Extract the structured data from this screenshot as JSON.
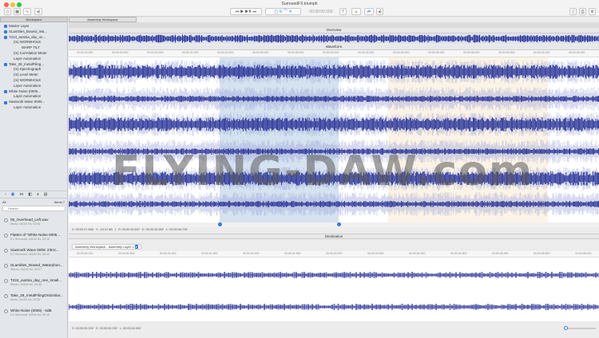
{
  "window": {
    "title": "SurroundFX.triumph",
    "timecode": "00:00:00.000"
  },
  "sidebar": {
    "tab": "Workspace",
    "tree": [
      "Master Layer",
      "SLambles_Bowed_Wa...",
      "T224_austria_day_on...",
      "(m) WORMHOLE",
      "WARP TILT",
      "(m) Correlation Meter",
      "Layer Automation",
      "Take_28_metalFiling...",
      "(m) Spectrograph",
      "(m) Level Meter",
      "(m) WORMHOLE",
      "Layer Automation",
      "White Noise (0005...",
      "Layer Automation",
      "Sawtooth Wave 0006...",
      "Layer Automation"
    ],
    "filter_all": "All",
    "items_label": "Items 7",
    "search_placeholder": "Search",
    "items": [
      {
        "name": "06_Overhead_Left.wav",
        "sub": "Mono, 44100 Hz, 00:05"
      },
      {
        "name": "Flatten of \"White Noise 0005...",
        "sub": "5.1 Surround, 44100 Hz, 00:10"
      },
      {
        "name": "Sawtooth Wave 0006: 23Hz...",
        "sub": "5.1 Surround, 44100 Hz, 00:10"
      },
      {
        "name": "SLambles_Bowed_Waterphon...",
        "sub": "Stereo, 44100 Hz, 00:27"
      },
      {
        "name": "T224_austria_day_one_small...",
        "sub": "Stereo, 44100 Hz, 00:45"
      },
      {
        "name": "Take_28_metalFilingOnSimilar...",
        "sub": "Mono, 44100 Hz, 00:30"
      },
      {
        "name": "White Noise (0005) - 6dB",
        "sub": "5.1 Surround, 44100 Hz, 00:10"
      }
    ]
  },
  "main": {
    "tab": "Assembly Workspace",
    "clips": [
      "Master Layer",
      "SLambles_Bowed_Waterph...",
      "T224_austria_day_one_sm...",
      "Take_28_metalFilingOnSim...",
      "White Noise 0005 - 6dB",
      "Sawtooth Wave 0006: 23H..."
    ],
    "overview_label": "Overview",
    "waveform_label": "Waveform",
    "ruler": [
      "00:00:16.000",
      "00:00:18.000",
      "00:00:20.000",
      "00:00:22.000",
      "00:00:24.000",
      "00:00:26.000",
      "00:00:28.000",
      "00:00:30.000",
      "00:00:32.000",
      "00:00:34.000",
      "00:00:36.000",
      "00:00:38.000",
      "00:00:40.000",
      "00:00:42.000",
      "00:00:44.000"
    ],
    "status": "X: 00:00:27.666   Y: -15.12 dB   |   S: 00:00:33.847   E: 00:00:35.652   L: 00:00:06.795",
    "destination_label": "Destination",
    "layer_select": "Assembly Workspace - Assembly Layer 1",
    "dest_ruler": [
      "00:00:00.000",
      "00:00:00.500",
      "00:00:01.000",
      "00:00:01.500",
      "00:00:02.000",
      "00:00:02.500",
      "00:00:03.000",
      "00:00:03.500",
      "00:00:04.000",
      "00:00:04.500",
      "00:00:05.000",
      "00:00:05.500",
      "00:00:06.000"
    ],
    "dest_status": "S: 00:00:00.000   E: 00:00:00.000   L: 00:00:00.000"
  },
  "watermark": "FLYING-DAW.com",
  "colors": {
    "wave": "#2a3597",
    "accent": "#2f7ae5",
    "selection": "#b9cfe6"
  }
}
